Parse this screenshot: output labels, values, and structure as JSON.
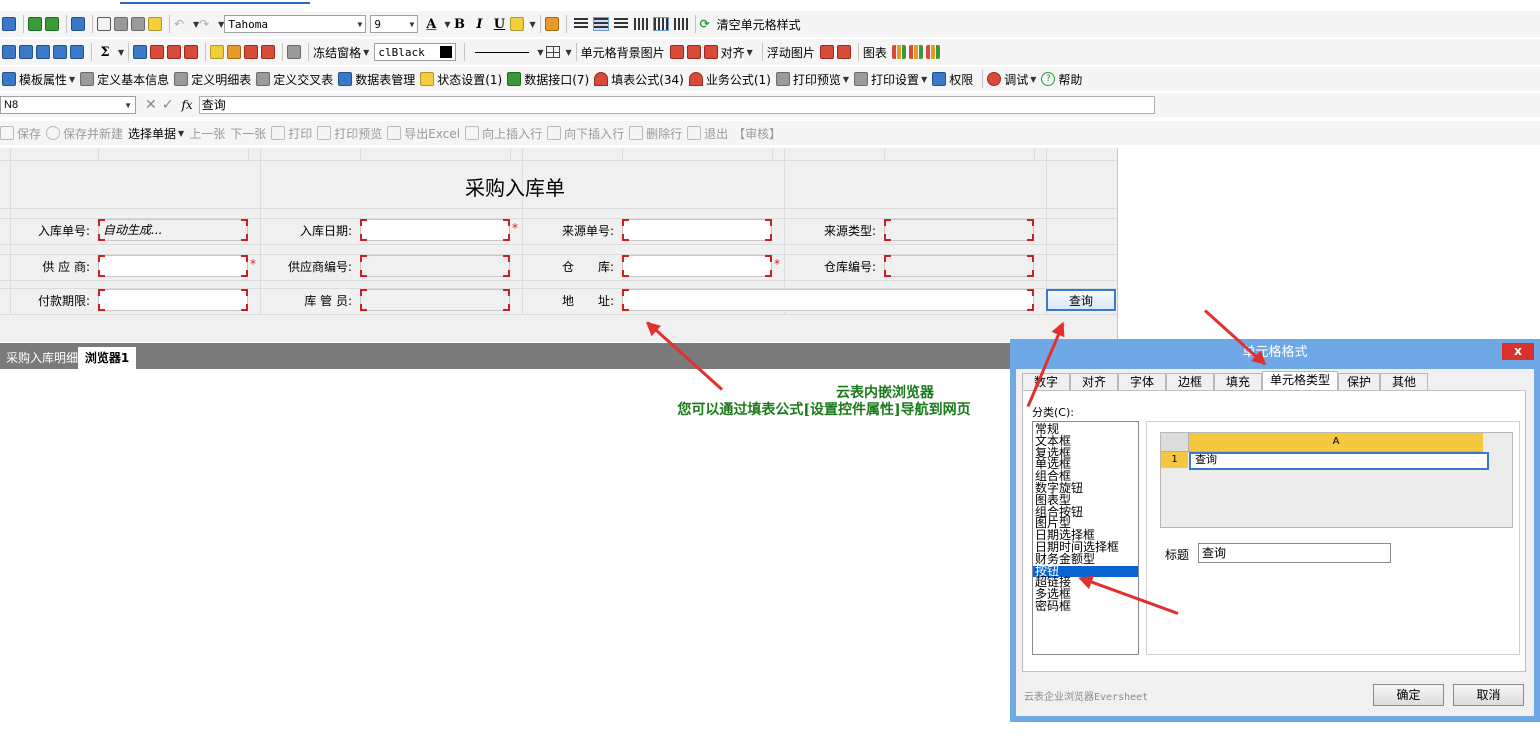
{
  "toolbar1": {
    "font_name": "Tahoma",
    "font_size": "9",
    "bold": "B",
    "italic": "I",
    "underline": "U",
    "clear_style": "清空单元格样式"
  },
  "toolbar2": {
    "sigma": "Σ",
    "freeze": "冻结窗格",
    "color_name": "clBlack",
    "cell_bg_image": "单元格背景图片",
    "align": "对齐",
    "float_image": "浮动图片",
    "chart": "图表"
  },
  "toolbar3": {
    "items": [
      "模板属性",
      "定义基本信息",
      "定义明细表",
      "定义交叉表",
      "数据表管理",
      "状态设置(1)",
      "数据接口(7)",
      "填表公式(34)",
      "业务公式(1)",
      "打印预览",
      "打印设置",
      "权限",
      "调试",
      "帮助"
    ]
  },
  "formula_bar": {
    "cell_ref": "N8",
    "fx": "fx",
    "value": "查询"
  },
  "action_bar": {
    "items": [
      "保存",
      "保存并新建",
      "选择单据",
      "上一张",
      "下一张",
      "打印",
      "打印预览",
      "导出Excel",
      "向上插入行",
      "向下插入行",
      "删除行",
      "退出",
      "【审核】"
    ]
  },
  "form": {
    "title": "采购入库单",
    "fields": [
      {
        "label": "入库单号:",
        "value": "自动生成..."
      },
      {
        "label": "入库日期:",
        "value": ""
      },
      {
        "label": "来源单号:",
        "value": ""
      },
      {
        "label": "来源类型:",
        "value": ""
      },
      {
        "label": "供 应 商:",
        "value": ""
      },
      {
        "label": "供应商编号:",
        "value": ""
      },
      {
        "label": "仓　　库:",
        "value": ""
      },
      {
        "label": "仓库编号:",
        "value": ""
      },
      {
        "label": "付款期限:",
        "value": ""
      },
      {
        "label": "库 管 员:",
        "value": ""
      },
      {
        "label": "地　　址:",
        "value": ""
      }
    ],
    "query_button": "查询",
    "required_mark": "*"
  },
  "sheet_tabs": [
    "采购入库明细",
    "浏览器1"
  ],
  "annotation": {
    "line1": "云表内嵌浏览器",
    "line2": "您可以通过填表公式[设置控件属性]导航到网页"
  },
  "dialog": {
    "title": "单元格格式",
    "close": "x",
    "tabs": [
      "数字",
      "对齐",
      "字体",
      "边框",
      "填充",
      "单元格类型",
      "保护",
      "其他"
    ],
    "active_tab": "单元格类型",
    "category_label": "分类(C):",
    "categories": [
      "常规",
      "文本框",
      "复选框",
      "单选框",
      "组合框",
      "数字旋钮",
      "图表型",
      "组合按钮",
      "图片型",
      "日期选择框",
      "日期时间选择框",
      "财务金额型",
      "按钮",
      "超链接",
      "多选框",
      "密码框"
    ],
    "selected_category": "按钮",
    "preview": {
      "col_header": "A",
      "row_header": "1",
      "cell_value": "查询"
    },
    "caption_label": "标题",
    "caption_value": "查询",
    "footer_brand": "云表企业浏览器Eversheet",
    "ok": "确定",
    "cancel": "取消"
  },
  "colors": {
    "dialog_frame": "#6fa8e6",
    "close_red": "#d9322b",
    "annotation_green": "#1a7a1a",
    "arrow_red": "#e03030",
    "required_red": "#e02020",
    "selected_blue": "#0a64d0"
  }
}
